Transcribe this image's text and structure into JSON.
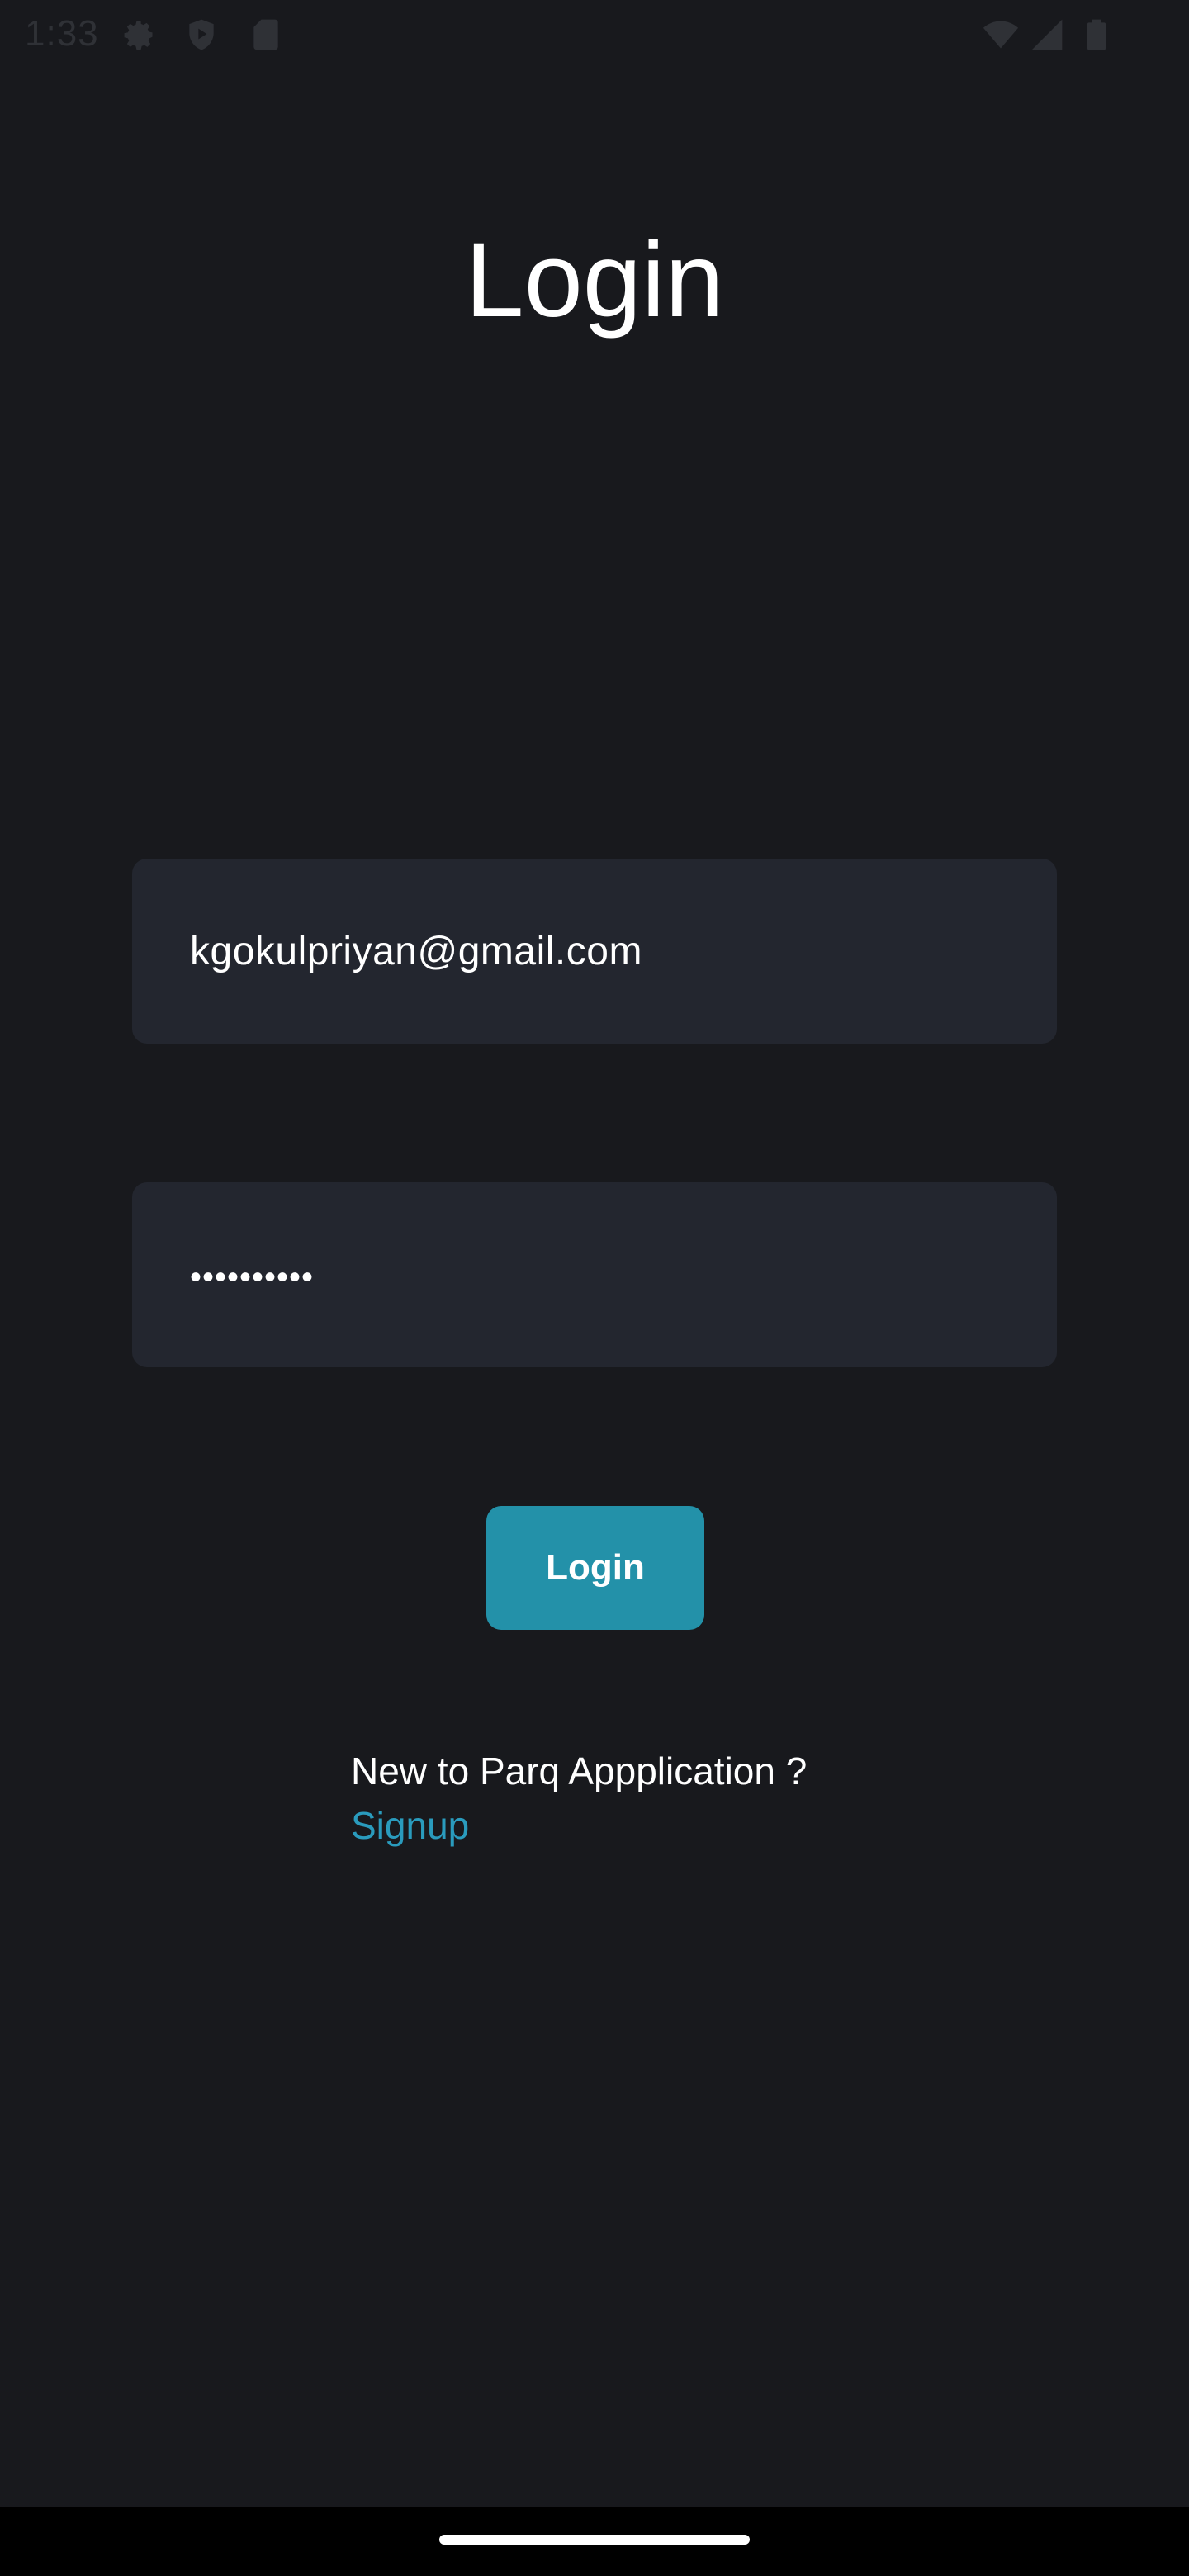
{
  "status_bar": {
    "time": "1:33",
    "icons": [
      "gear-icon",
      "shield-play-icon",
      "sd-card-icon",
      "wifi-icon",
      "signal-icon",
      "battery-icon"
    ]
  },
  "page": {
    "title": "Login"
  },
  "form": {
    "email_value": "kgokulpriyan@gmail.com",
    "password_value": "••••••••••",
    "login_button_label": "Login"
  },
  "signup": {
    "prompt": "New to Parq Appplication ?",
    "link_label": "Signup"
  },
  "colors": {
    "background": "#18191d",
    "field_background": "#23262f",
    "accent": "#2391a9",
    "link": "#2a9bbd"
  }
}
